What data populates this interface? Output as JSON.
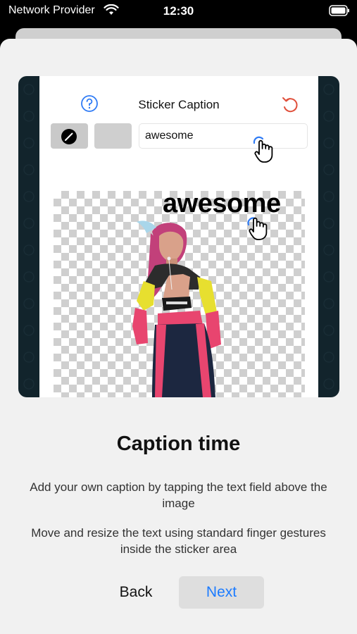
{
  "status_bar": {
    "carrier": "Network Provider",
    "time": "12:30",
    "icons": [
      "wifi-icon",
      "battery-icon"
    ]
  },
  "editor": {
    "title": "Sticker Caption",
    "help_icon": "question-circle-icon",
    "undo_icon": "undo-icon",
    "tool_icon": "pen-icon",
    "caption_input_value": "awesome",
    "sticker_caption_text": "awesome",
    "colors": {
      "accent_blue": "#2f7bf5",
      "undo_red": "#e0503c",
      "preview_frame": "#12242c"
    }
  },
  "onboarding": {
    "heading": "Caption time",
    "description_1": "Add your own caption by tapping the text field above the image",
    "description_2": "Move and resize the text using standard finger gestures inside the sticker area",
    "back_label": "Back",
    "next_label": "Next",
    "next_color": "#1b7bff"
  }
}
